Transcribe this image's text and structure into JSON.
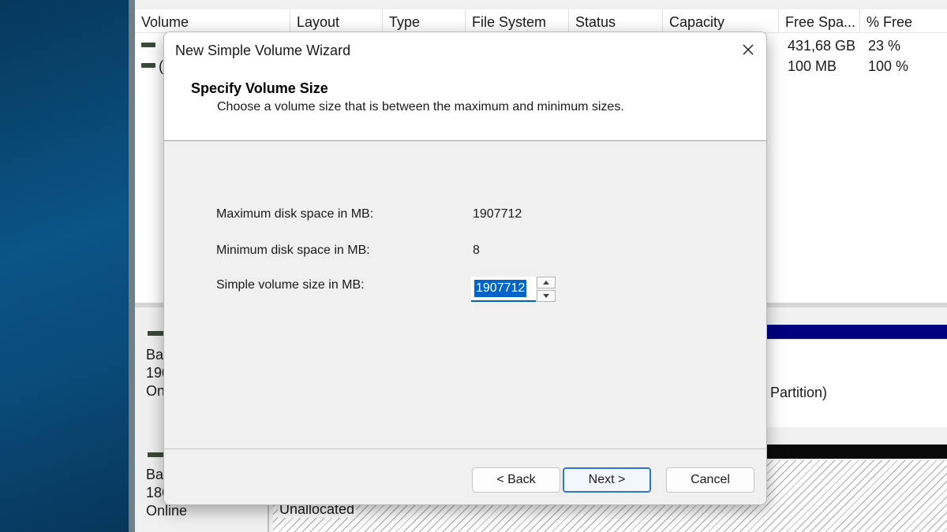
{
  "disk_management": {
    "columns": [
      "Volume",
      "Layout",
      "Type",
      "File System",
      "Status",
      "Capacity",
      "Free Spa...",
      "% Free"
    ],
    "rows": [
      {
        "volume": "",
        "free_space": "431,68 GB",
        "percent_free": "23 %"
      },
      {
        "volume": "(",
        "free_space": "100 MB",
        "percent_free": "100 %"
      }
    ],
    "disks": [
      {
        "line1": "Ba",
        "line2": "190",
        "line3": "Onl"
      },
      {
        "line1": "Ba",
        "line2": "186",
        "line3": "Online"
      }
    ],
    "partition_label": "Partition)",
    "unallocated_label": "Unallocated"
  },
  "dialog": {
    "title": "New Simple Volume Wizard",
    "header_title": "Specify Volume Size",
    "header_subtitle": "Choose a volume size that is between the maximum and minimum sizes.",
    "fields": {
      "max_label": "Maximum disk space in MB:",
      "max_value": "1907712",
      "min_label": "Minimum disk space in MB:",
      "min_value": "8",
      "size_label": "Simple volume size in MB:",
      "size_value": "1907712"
    },
    "buttons": {
      "back": "< Back",
      "next": "Next >",
      "cancel": "Cancel"
    }
  },
  "icons": {
    "close": "close-icon",
    "spin_up": "spin-up-icon",
    "spin_down": "spin-down-icon"
  }
}
